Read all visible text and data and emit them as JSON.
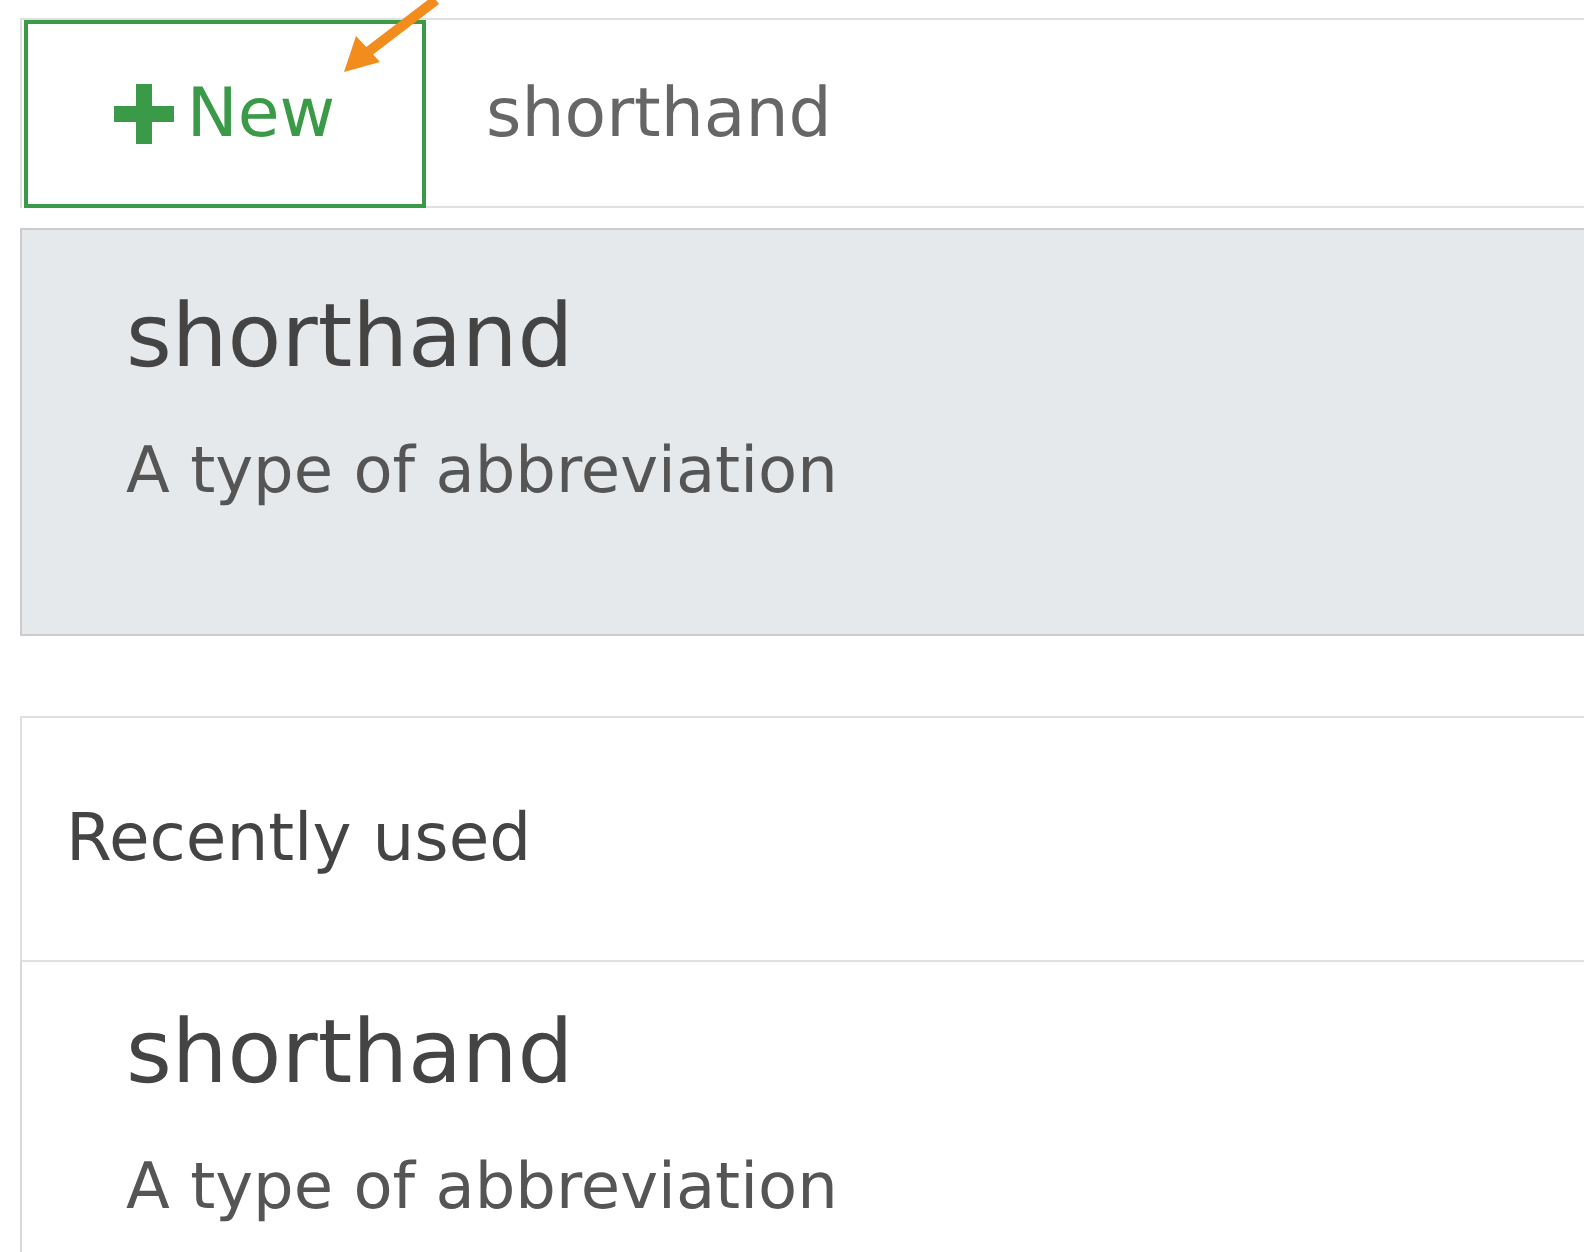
{
  "new_button": {
    "label": "New"
  },
  "search": {
    "value": "shorthand"
  },
  "results": [
    {
      "title": "shorthand",
      "description": "A type of abbreviation",
      "selected": true
    }
  ],
  "recently_used": {
    "heading": "Recently used",
    "items": [
      {
        "title": "shorthand",
        "description": "A type of abbreviation",
        "selected": false
      }
    ]
  }
}
